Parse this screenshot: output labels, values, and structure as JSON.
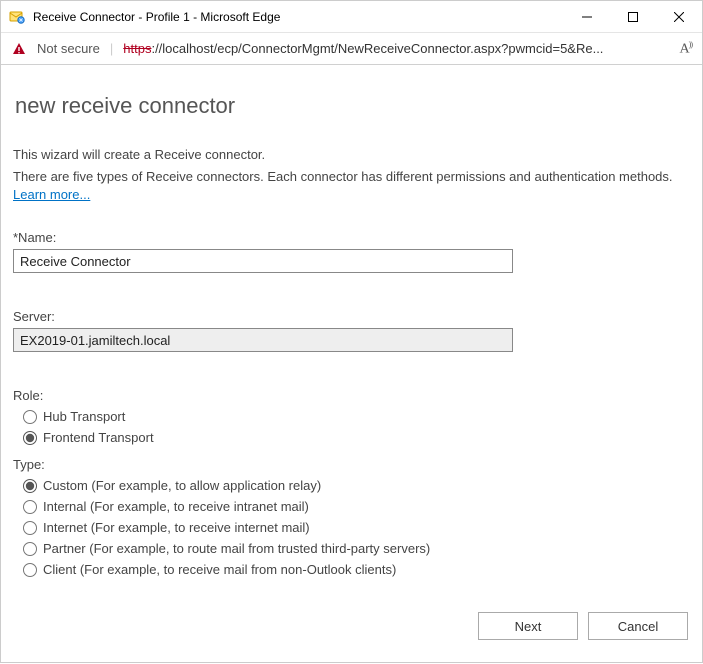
{
  "window": {
    "title": "Receive Connector - Profile 1 - Microsoft Edge"
  },
  "addressbar": {
    "not_secure": "Not secure",
    "url_https": "https",
    "url_rest": "://localhost/ecp/ConnectorMgmt/NewReceiveConnector.aspx?pwmcid=5&Re...",
    "read_aloud": "A))"
  },
  "page": {
    "heading": "new receive connector",
    "intro1": "This wizard will create a Receive connector.",
    "intro2": "There are five types of Receive connectors. Each connector has different permissions and authentication methods. ",
    "learn_more": "Learn more...",
    "name_label": "*Name:",
    "name_value": "Receive Connector",
    "server_label": "Server:",
    "server_value": "EX2019-01.jamiltech.local",
    "role_label": "Role:",
    "role_options": [
      "Hub Transport",
      "Frontend Transport"
    ],
    "role_selected_index": 1,
    "type_label": "Type:",
    "type_options": [
      "Custom (For example, to allow application relay)",
      "Internal (For example, to receive intranet mail)",
      "Internet (For example, to receive internet mail)",
      "Partner (For example, to route mail from trusted third-party servers)",
      "Client (For example, to receive mail from non-Outlook clients)"
    ],
    "type_selected_index": 0,
    "buttons": {
      "next": "Next",
      "cancel": "Cancel"
    }
  }
}
